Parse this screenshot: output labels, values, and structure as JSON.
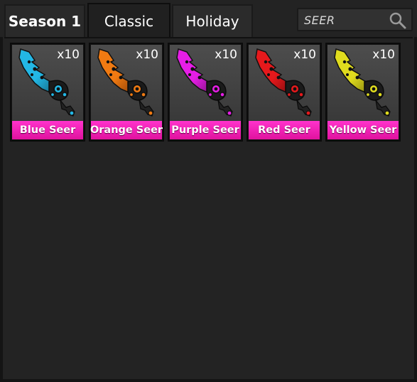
{
  "tabs": {
    "season": "Season 1",
    "classic": "Classic",
    "holiday": "Holiday"
  },
  "search": {
    "value": "SEER",
    "icon": "search-icon"
  },
  "items": [
    {
      "name": "Blue Seer",
      "qty": "x10",
      "color": "#23b7e5",
      "dark": "#12607a",
      "icon": "seer-knife-icon"
    },
    {
      "name": "Orange Seer",
      "qty": "x10",
      "color": "#f07a12",
      "dark": "#8a3c05",
      "icon": "seer-knife-icon"
    },
    {
      "name": "Purple Seer",
      "qty": "x10",
      "color": "#e61ee6",
      "dark": "#7a0f7a",
      "icon": "seer-knife-icon"
    },
    {
      "name": "Red Seer",
      "qty": "x10",
      "color": "#e6191c",
      "dark": "#7a0a0c",
      "icon": "seer-knife-icon"
    },
    {
      "name": "Yellow Seer",
      "qty": "x10",
      "color": "#e0dc1e",
      "dark": "#7d7a0c",
      "icon": "seer-knife-icon"
    }
  ]
}
